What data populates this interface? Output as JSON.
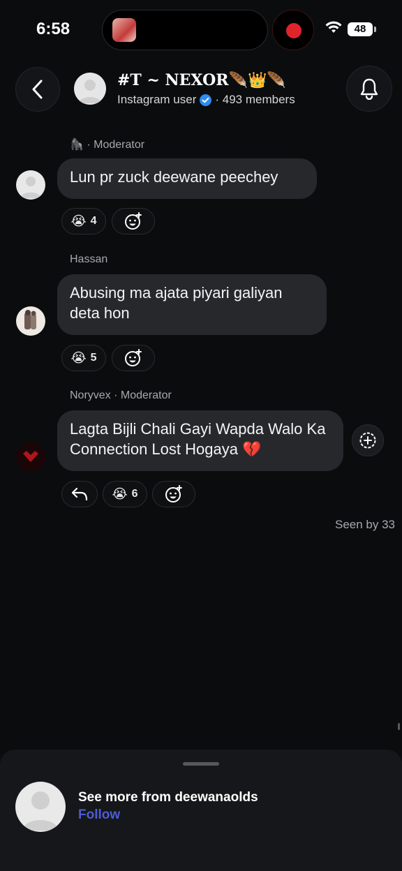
{
  "status_bar": {
    "time": "6:58",
    "battery": "48"
  },
  "header": {
    "title": "#T ~ NEXOR🪶👑🪶",
    "subtitle_prefix": "Instagram user",
    "members": "· 493 members"
  },
  "messages": [
    {
      "sender": "🦍 · Moderator",
      "text": "Lun pr zuck deewane peechey",
      "reaction_emoji": "😭",
      "reaction_count": "4"
    },
    {
      "sender": "Hassan",
      "text": "Abusing ma ajata piyari galiyan deta hon",
      "reaction_emoji": "😭",
      "reaction_count": "5"
    },
    {
      "sender": "Noryvex · Moderator",
      "text": "Lagta Bijli Chali Gayi Wapda Walo Ka Connection Lost Hogaya 💔",
      "reaction_emoji": "😭",
      "reaction_count": "6"
    }
  ],
  "seen_by": "Seen by 33",
  "bottom_sheet": {
    "title": "See more from deewanaolds",
    "follow_label": "Follow"
  },
  "icons": {
    "back": "chevron-left-icon",
    "bell": "bell-icon",
    "add_reaction": "add-emoji-icon",
    "reply": "reply-icon",
    "add": "add-circle-icon"
  },
  "colors": {
    "follow": "#4f5bd5",
    "verified": "#2d8cf0",
    "record": "#e0242b"
  }
}
